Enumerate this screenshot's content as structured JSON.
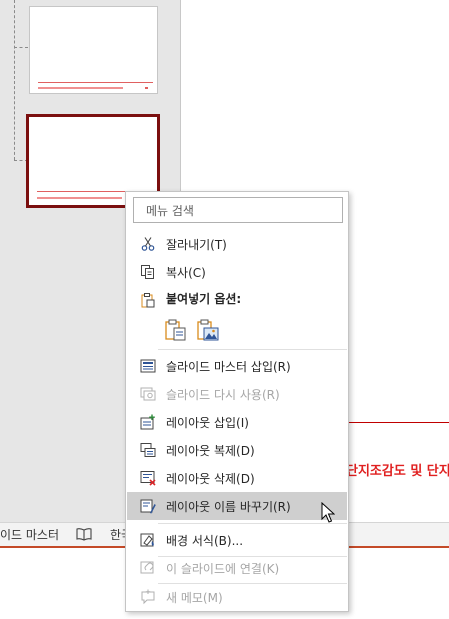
{
  "context_menu": {
    "search_placeholder": "메뉴 검색",
    "cut": "잘라내기(T)",
    "copy": "복사(C)",
    "paste_options": "붙여넣기 옵션:",
    "insert_slide_master": "슬라이드 마스터 삽입(R)",
    "reuse_slides": "슬라이드 다시 사용(R)",
    "insert_layout": "레이아웃 삽입(I)",
    "duplicate_layout": "레이아웃 복제(D)",
    "delete_layout": "레이아웃 삭제(D)",
    "rename_layout": "레이아웃 이름 바꾸기(R)",
    "format_background": "배경 서식(B)...",
    "link_to_slide": "이 슬라이드에 연결(K)",
    "new_comment": "새 메모(M)"
  },
  "status_bar": {
    "view_label": "이드 마스터",
    "language_label": "한국"
  },
  "slide": {
    "visible_text": "단지조감도 및 단지"
  },
  "colors": {
    "selected_thumbnail_border": "#7b0f0f",
    "accent_red": "#e02020",
    "menu_highlight": "#cfcfcf",
    "icon_blue": "#2f5597",
    "icon_orange": "#d98b1c"
  }
}
